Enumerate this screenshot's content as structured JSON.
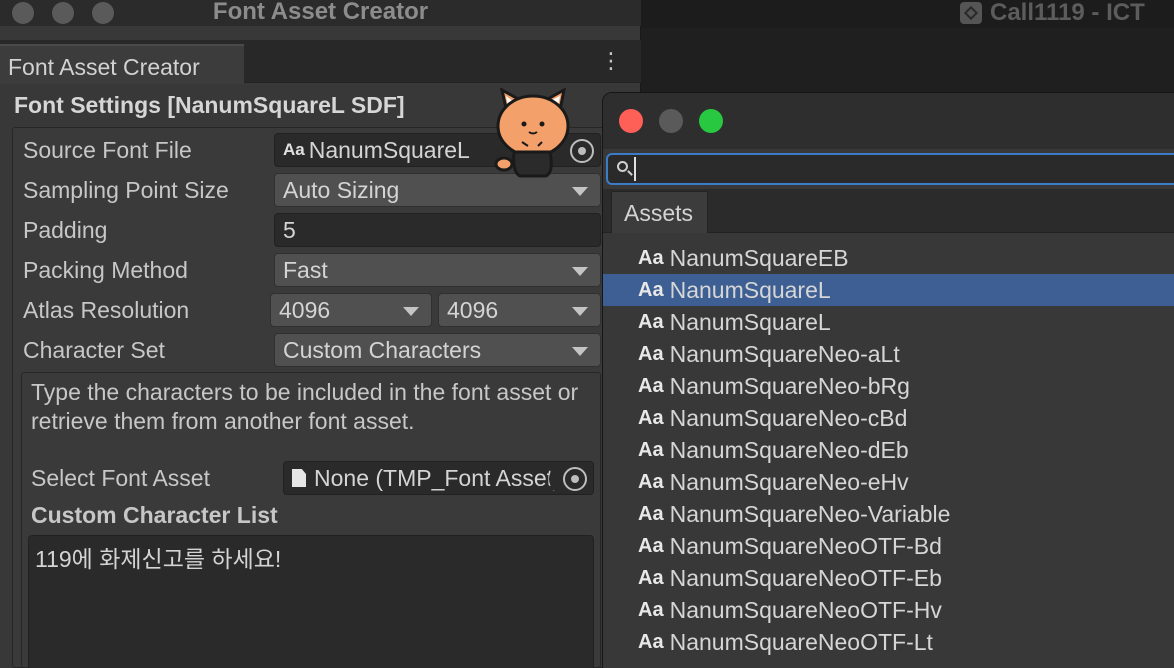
{
  "background_window": {
    "title": "Call1119 - ICT"
  },
  "editor": {
    "window_title": "Font Asset Creator",
    "tab_label": "Font Asset Creator",
    "menu_glyph": "⋮",
    "section_header": "Font Settings [NanumSquareL SDF]",
    "fields": {
      "source_font_file": {
        "label": "Source Font File",
        "value": "NanumSquareL",
        "icon": "Aa"
      },
      "sampling_point_size": {
        "label": "Sampling Point Size",
        "value": "Auto Sizing"
      },
      "padding": {
        "label": "Padding",
        "value": "5"
      },
      "packing_method": {
        "label": "Packing Method",
        "value": "Fast"
      },
      "atlas_resolution": {
        "label": "Atlas Resolution",
        "width": "4096",
        "height": "4096"
      },
      "character_set": {
        "label": "Character Set",
        "value": "Custom Characters"
      }
    },
    "help_text": "Type the characters to be included in the font asset or retrieve them from another font asset.",
    "select_font_asset": {
      "label": "Select Font Asset",
      "value": "None (TMP_Font Asset)"
    },
    "custom_character_list": {
      "label": "Custom Character List",
      "value": "119에 화제신고를 하세요!"
    }
  },
  "picker": {
    "search_placeholder": "",
    "tab_label": "Assets",
    "items": [
      {
        "label": "NanumSquareEB",
        "selected": false
      },
      {
        "label": "NanumSquareL",
        "selected": true
      },
      {
        "label": "NanumSquareL",
        "selected": false
      },
      {
        "label": "NanumSquareNeo-aLt",
        "selected": false
      },
      {
        "label": "NanumSquareNeo-bRg",
        "selected": false
      },
      {
        "label": "NanumSquareNeo-cBd",
        "selected": false
      },
      {
        "label": "NanumSquareNeo-dEb",
        "selected": false
      },
      {
        "label": "NanumSquareNeo-eHv",
        "selected": false
      },
      {
        "label": "NanumSquareNeo-Variable",
        "selected": false
      },
      {
        "label": "NanumSquareNeoOTF-Bd",
        "selected": false
      },
      {
        "label": "NanumSquareNeoOTF-Eb",
        "selected": false
      },
      {
        "label": "NanumSquareNeoOTF-Hv",
        "selected": false
      },
      {
        "label": "NanumSquareNeoOTF-Lt",
        "selected": false
      }
    ],
    "item_icon": "Aa"
  },
  "colors": {
    "selection": "#3d5f93",
    "search_focus": "#3b7bc8",
    "close": "#fe5f57",
    "minimize": "#5a5a5a",
    "zoom": "#28c840"
  }
}
